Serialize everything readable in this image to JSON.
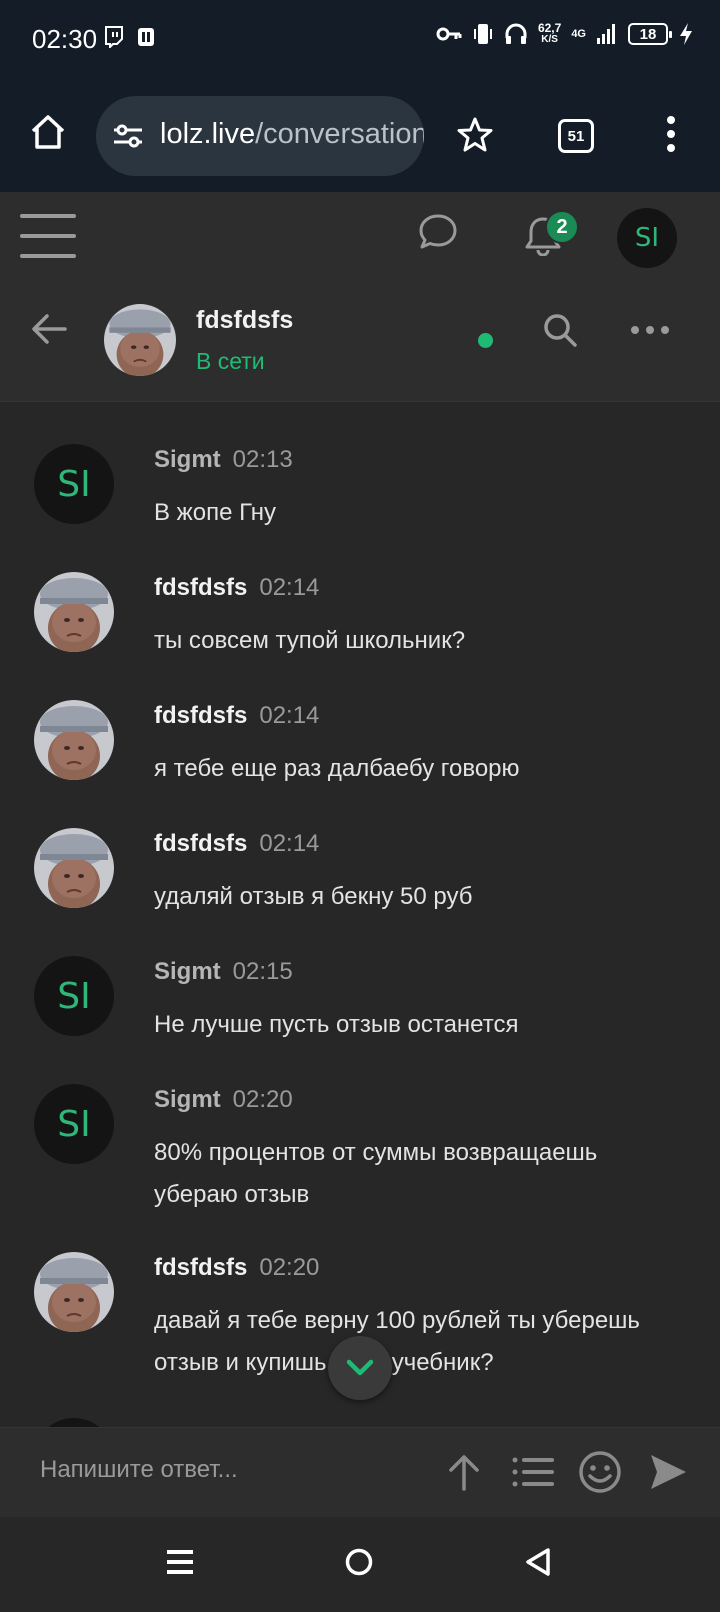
{
  "status_bar": {
    "time": "02:30",
    "net_speed_value": "62,7",
    "net_speed_unit": "K/S",
    "network": "4G",
    "battery": "18"
  },
  "browser": {
    "url_host": "lolz.live",
    "url_path": "/conversations/",
    "tab_count": "51"
  },
  "site_header": {
    "notification_count": "2",
    "user_initials": "SI"
  },
  "conversation": {
    "name": "fdsfdsfs",
    "status": "В сети"
  },
  "messages": [
    {
      "author": "Sigmt",
      "time": "02:13",
      "text": "В жопе Гну",
      "mine": true,
      "initials": "SI"
    },
    {
      "author": "fdsfdsfs",
      "time": "02:14",
      "text": "ты совсем тупой школьник?",
      "mine": false
    },
    {
      "author": "fdsfdsfs",
      "time": "02:14",
      "text": "я тебе еще раз далбаебу говорю",
      "mine": false
    },
    {
      "author": "fdsfdsfs",
      "time": "02:14",
      "text": "удаляй отзыв я бекну 50 руб",
      "mine": false
    },
    {
      "author": "Sigmt",
      "time": "02:15",
      "text": "Не лучше пусть отзыв останется",
      "mine": true,
      "initials": "SI"
    },
    {
      "author": "Sigmt",
      "time": "02:20",
      "text": "80% процентов от суммы возвращаешь убераю отзыв",
      "mine": true,
      "initials": "SI"
    },
    {
      "author": "fdsfdsfs",
      "time": "02:20",
      "text": "давай я тебе верну 100 рублей ты уберешь отзыв и купишь себе учебник?",
      "mine": false
    }
  ],
  "reply": {
    "placeholder": "Напишите ответ..."
  },
  "colors": {
    "accent_green": "#1fba74",
    "badge_green": "#1b8b55",
    "background": "#272727",
    "browser_bar": "#141d27"
  }
}
